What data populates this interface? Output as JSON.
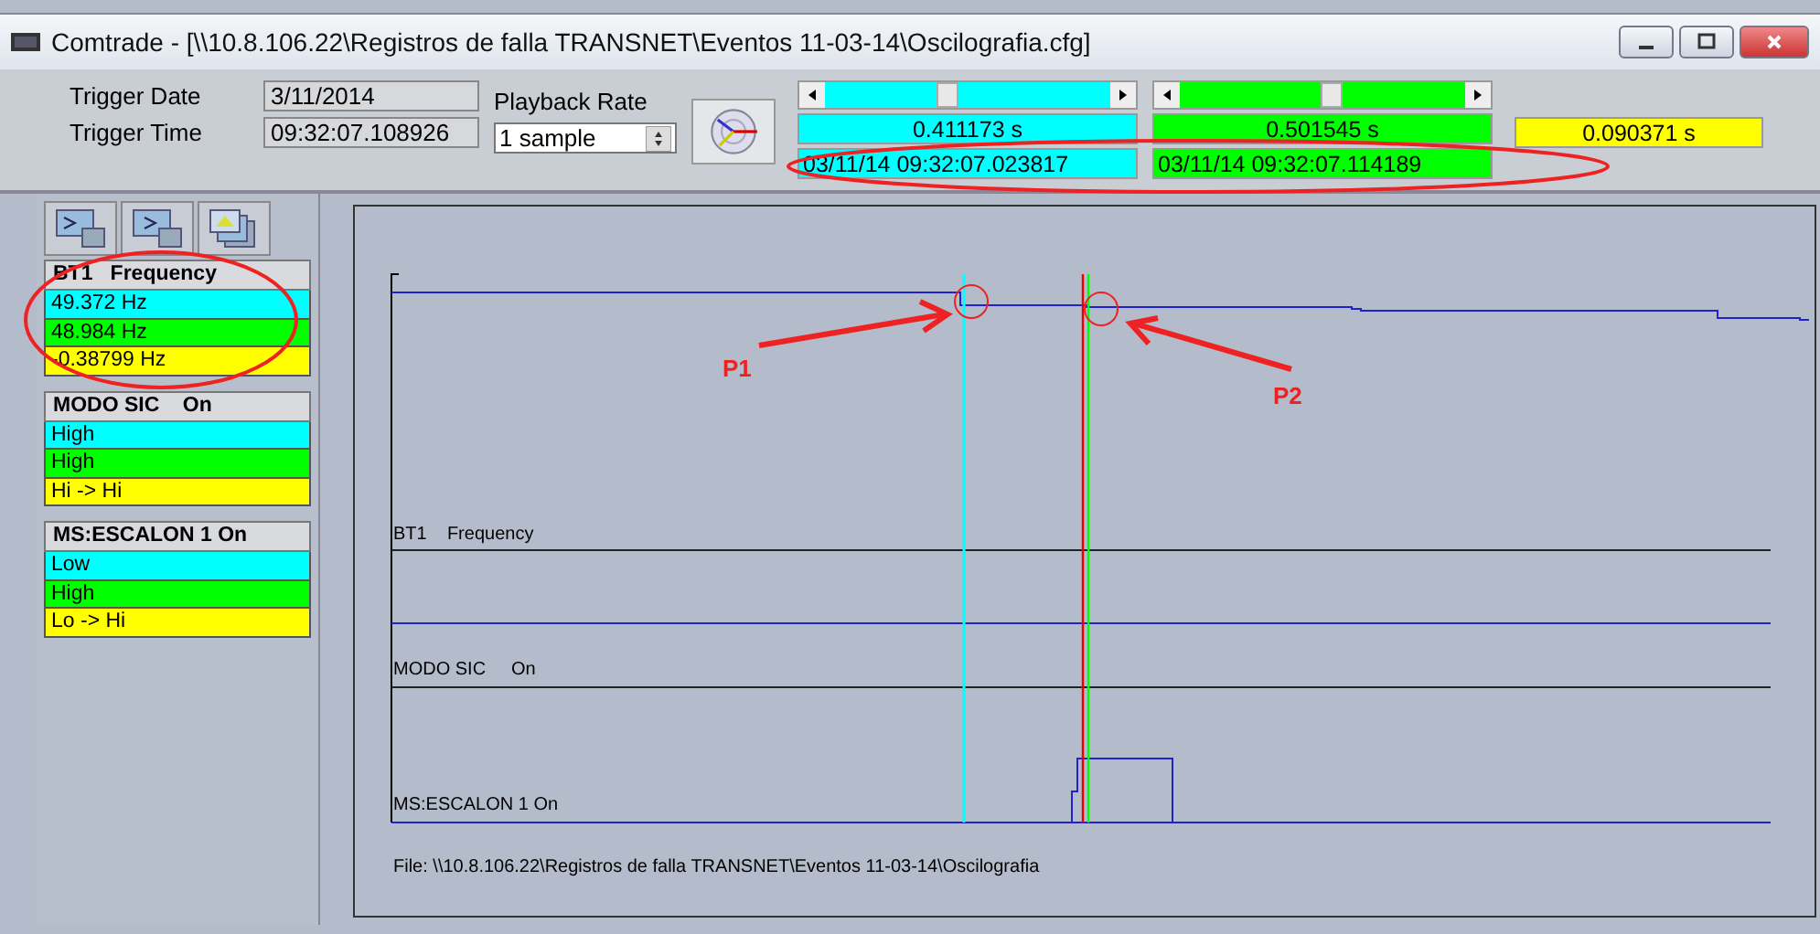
{
  "window": {
    "title": "Comtrade - [\\\\10.8.106.22\\Registros de falla TRANSNET\\Eventos 11-03-14\\Oscilografia.cfg]"
  },
  "trigger": {
    "date_label": "Trigger Date",
    "date": "3/11/2014",
    "time_label": "Trigger Time",
    "time": "09:32:07.108926"
  },
  "playback": {
    "label": "Playback Rate",
    "value": "1 sample"
  },
  "cursors": [
    {
      "color": "#00ffff",
      "level": 0.43,
      "seconds": "0.411173 s",
      "timestamp": "03/11/14 09:32:07.023817"
    },
    {
      "color": "#00ff00",
      "level": 0.53,
      "seconds": "0.501545 s",
      "timestamp": "03/11/14 09:32:07.114189"
    }
  ],
  "difference": {
    "color": "#ffff00",
    "seconds": "0.090371 s"
  },
  "channels": [
    {
      "name": "BT1   Frequency",
      "values": [
        "49.372 Hz",
        "48.984 Hz",
        "-0.38799 Hz"
      ]
    },
    {
      "name": "MODO SIC    On",
      "values": [
        "High",
        "High",
        "Hi -> Hi"
      ]
    },
    {
      "name": "MS:ESCALON 1 On",
      "values": [
        "Low",
        "High",
        "Lo -> Hi"
      ]
    }
  ],
  "plot": {
    "trace_labels": [
      "BT1    Frequency",
      "MODO SIC     On",
      "MS:ESCALON 1 On"
    ],
    "file": "File: \\\\10.8.106.22\\Registros de falla TRANSNET\\Eventos 11-03-14\\Oscilografia"
  },
  "annotations": {
    "labels": [
      "P1",
      "P2"
    ]
  }
}
